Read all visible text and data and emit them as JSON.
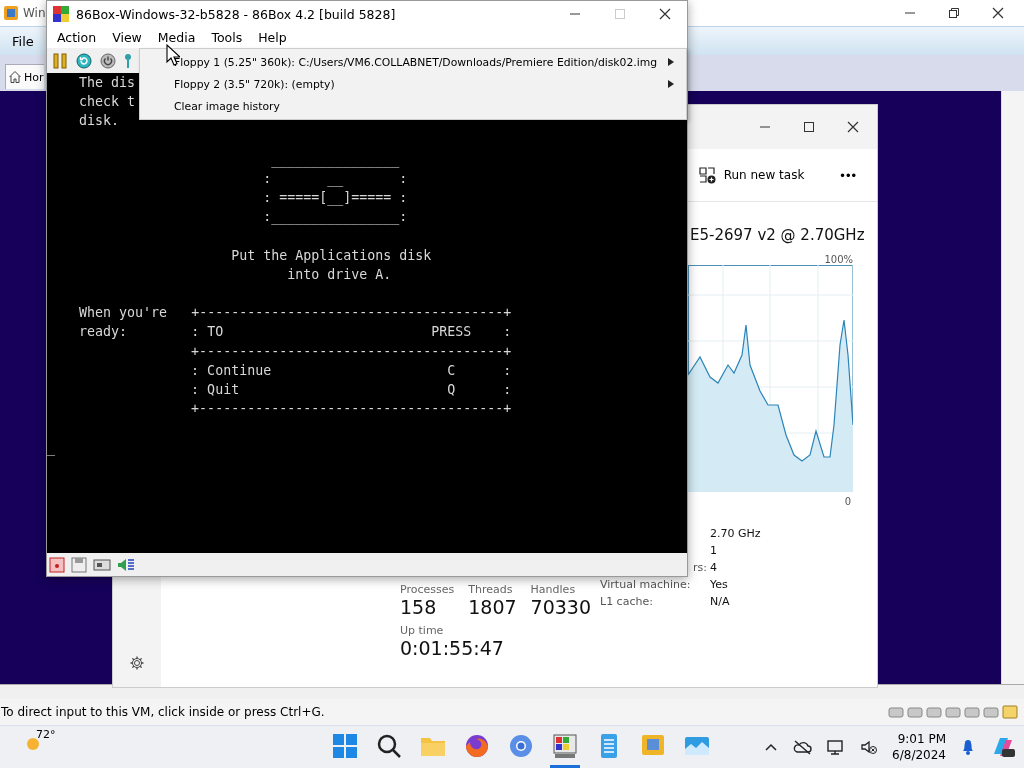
{
  "host_window": {
    "title": "Win",
    "menu": [
      "File"
    ],
    "tab": "Hor",
    "status_bar": "To direct input to this VM, click inside or press Ctrl+G."
  },
  "emulator_window": {
    "title": "86Box-Windows-32-b5828 - 86Box 4.2 [build 5828]",
    "menu": [
      "Action",
      "View",
      "Media",
      "Tools",
      "Help"
    ],
    "media_menu": [
      {
        "label": "Floppy 1 (5.25\" 360k): C:/Users/VM6.COLLABNET/Downloads/Premiere Edition/disk02.img",
        "submenu": true
      },
      {
        "label": "Floppy 2 (3.5\" 720k): (empty)",
        "submenu": true
      },
      {
        "label": "Clear image history",
        "submenu": false
      }
    ],
    "screen_blocks": [
      [
        "    The dis",
        "    check t",
        "    disk."
      ],
      [
        "                            ________________",
        "                           :       __       :",
        "                           : =====[__]===== :",
        "                           :________________:"
      ],
      [
        "                       Put the Applications disk",
        "                              into drive A."
      ],
      [
        "    When you're   +--------------------------------------+",
        "    ready:        : TO                          PRESS    :",
        "                  +--------------------------------------+",
        "                  : Continue                      C      :",
        "                  : Quit                          Q      :",
        "                  +--------------------------------------+"
      ],
      [
        "_"
      ]
    ]
  },
  "task_manager": {
    "command": "Run new task",
    "more": "•••",
    "cpu_name": "E5-2697 v2 @ 2.70GHz",
    "graph_max": "100%",
    "graph_min": "0",
    "stats": [
      {
        "label": "Processes",
        "value": "158"
      },
      {
        "label": "Threads",
        "value": "1807"
      },
      {
        "label": "Handles",
        "value": "70330"
      }
    ],
    "uptime_label": "Up time",
    "uptime": "0:01:55:47",
    "specs": [
      {
        "kind": "value",
        "value": "2.70 GHz"
      },
      {
        "kind": "value",
        "value": "1"
      },
      {
        "kind": "cut",
        "label": "rs:",
        "value": "4"
      },
      {
        "kind": "full",
        "label": "Virtual machine:",
        "value": "Yes"
      },
      {
        "kind": "full",
        "label": "L1 cache:",
        "value": "N/A"
      }
    ]
  },
  "taskbar": {
    "temperature": "72°",
    "time": "9:01 PM",
    "date": "6/8/2024"
  }
}
